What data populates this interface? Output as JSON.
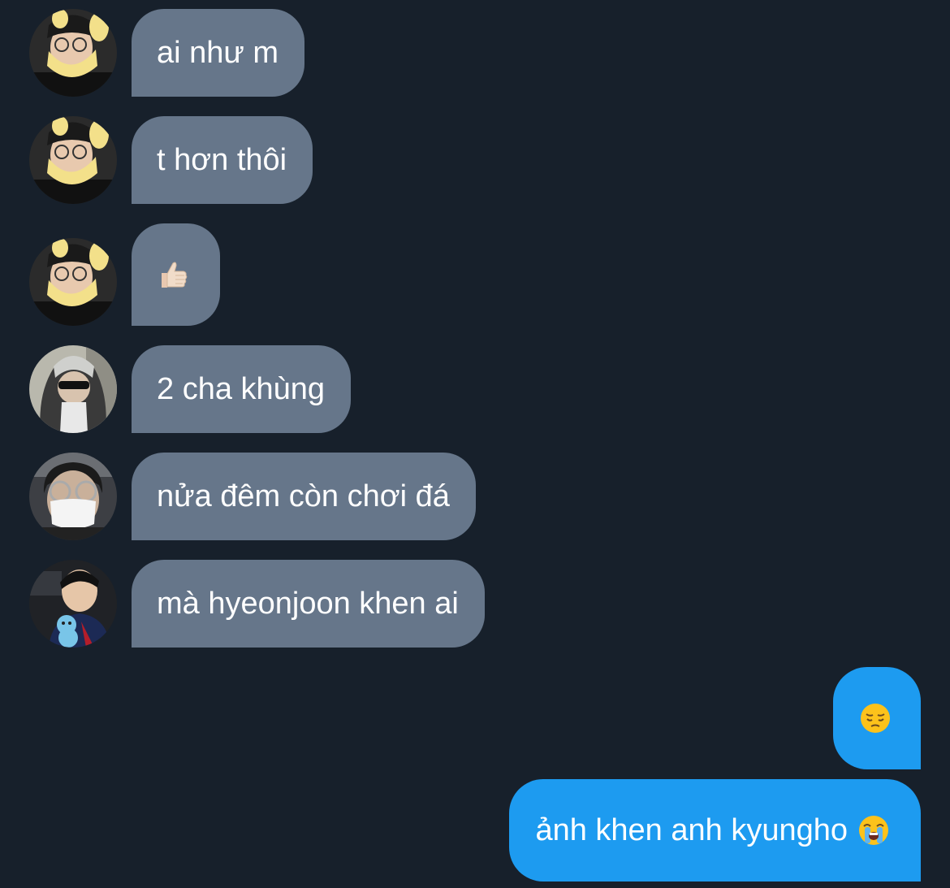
{
  "conversation": {
    "messages": [
      {
        "sender": "them",
        "avatar": "avatar-yellow-hood",
        "text": "ai như m"
      },
      {
        "sender": "them",
        "avatar": "avatar-yellow-hood",
        "text": "t hơn thôi"
      },
      {
        "sender": "them",
        "avatar": "avatar-yellow-hood",
        "emoji": "thumbs-up-icon"
      },
      {
        "sender": "them",
        "avatar": "avatar-hooded-gray",
        "text": "2 cha khùng"
      },
      {
        "sender": "them",
        "avatar": "avatar-masked-glasses",
        "text": "nửa đêm còn chơi đá"
      },
      {
        "sender": "them",
        "avatar": "avatar-plush-toy",
        "text": "mà hyeonjoon khen ai"
      },
      {
        "sender": "me",
        "emoji": "pensive-face-icon"
      },
      {
        "sender": "me",
        "text": "ảnh khen anh kyungho",
        "trailing_emoji": "loudly-crying-face-icon"
      }
    ]
  },
  "colors": {
    "background": "#17202b",
    "incoming_bubble": "#66768a",
    "outgoing_bubble": "#1d9bf0",
    "text": "#ffffff"
  }
}
